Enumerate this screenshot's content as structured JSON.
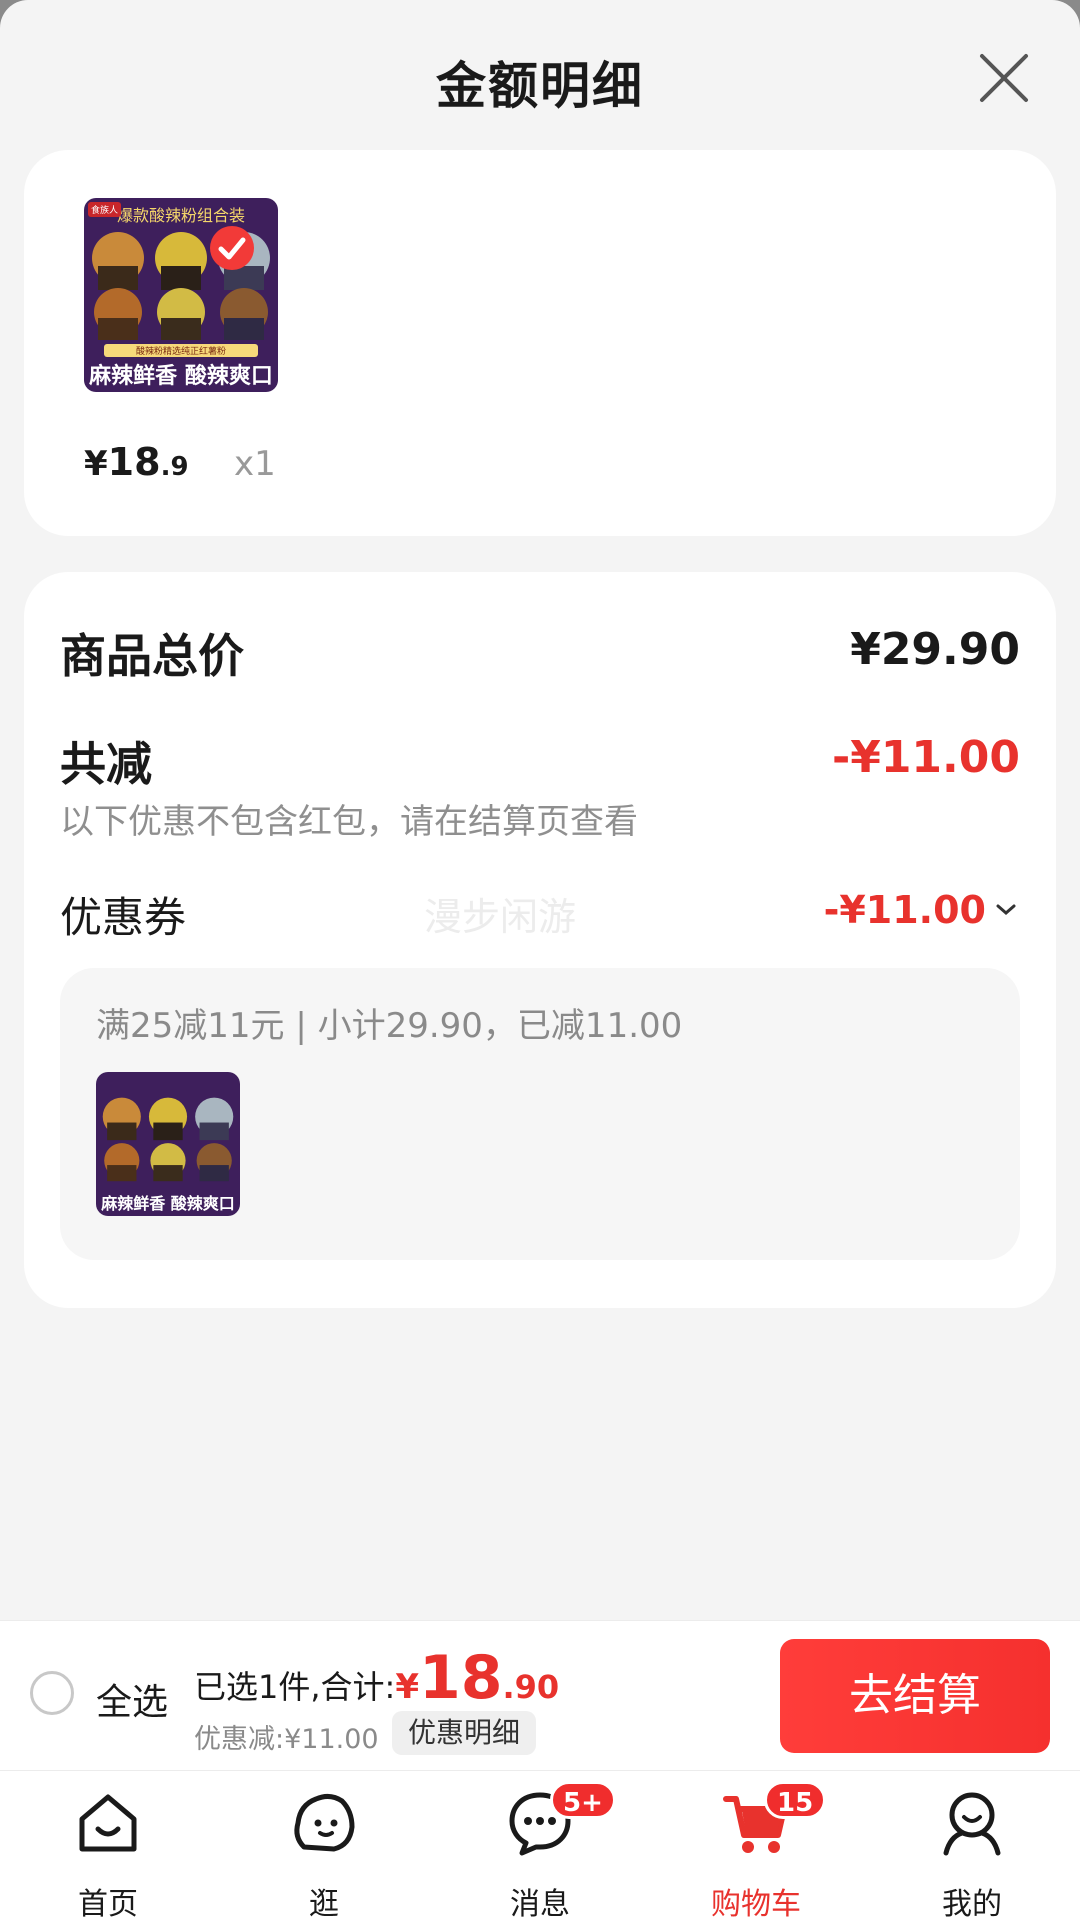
{
  "sheet": {
    "title": "金额明细"
  },
  "item_card": {
    "price_currency": "¥",
    "price_int": "18",
    "price_dec": ".9",
    "quantity": "x1",
    "thumb_text_top": "爆款酸辣粉组合装",
    "thumb_text_mid": "酸辣粉精选纯正红薯粉",
    "thumb_text_bottom": "麻辣鲜香 酸辣爽口",
    "thumb_brand": "食族人"
  },
  "summary": {
    "total_label": "商品总价",
    "total_value": "¥29.90",
    "discount_label": "共减",
    "discount_value": "-¥11.00",
    "discount_note": "以下优惠不包含红包，请在结算页查看",
    "coupon_label": "优惠券",
    "coupon_value": "-¥11.00",
    "watermark": "漫步闲游",
    "coupon_detail": "满25减11元 | 小计29.90，已减11.00"
  },
  "checkout": {
    "select_all": "全选",
    "selected_prefix": "已选1件,合计:",
    "total_currency": "¥",
    "total_int": "18",
    "total_dec": ".90",
    "saved": "优惠减:¥11.00",
    "detail_button": "优惠明细",
    "checkout_button": "去结算"
  },
  "tabs": [
    {
      "label": "首页",
      "icon": "home-icon"
    },
    {
      "label": "逛",
      "icon": "browse-icon"
    },
    {
      "label": "消息",
      "icon": "message-icon",
      "badge": "5+"
    },
    {
      "label": "购物车",
      "icon": "cart-icon",
      "badge": "15",
      "active": true
    },
    {
      "label": "我的",
      "icon": "profile-icon"
    }
  ],
  "colors": {
    "accent": "#e8322d",
    "checkout_button": "#f23a38",
    "background": "#f4f4f4"
  }
}
